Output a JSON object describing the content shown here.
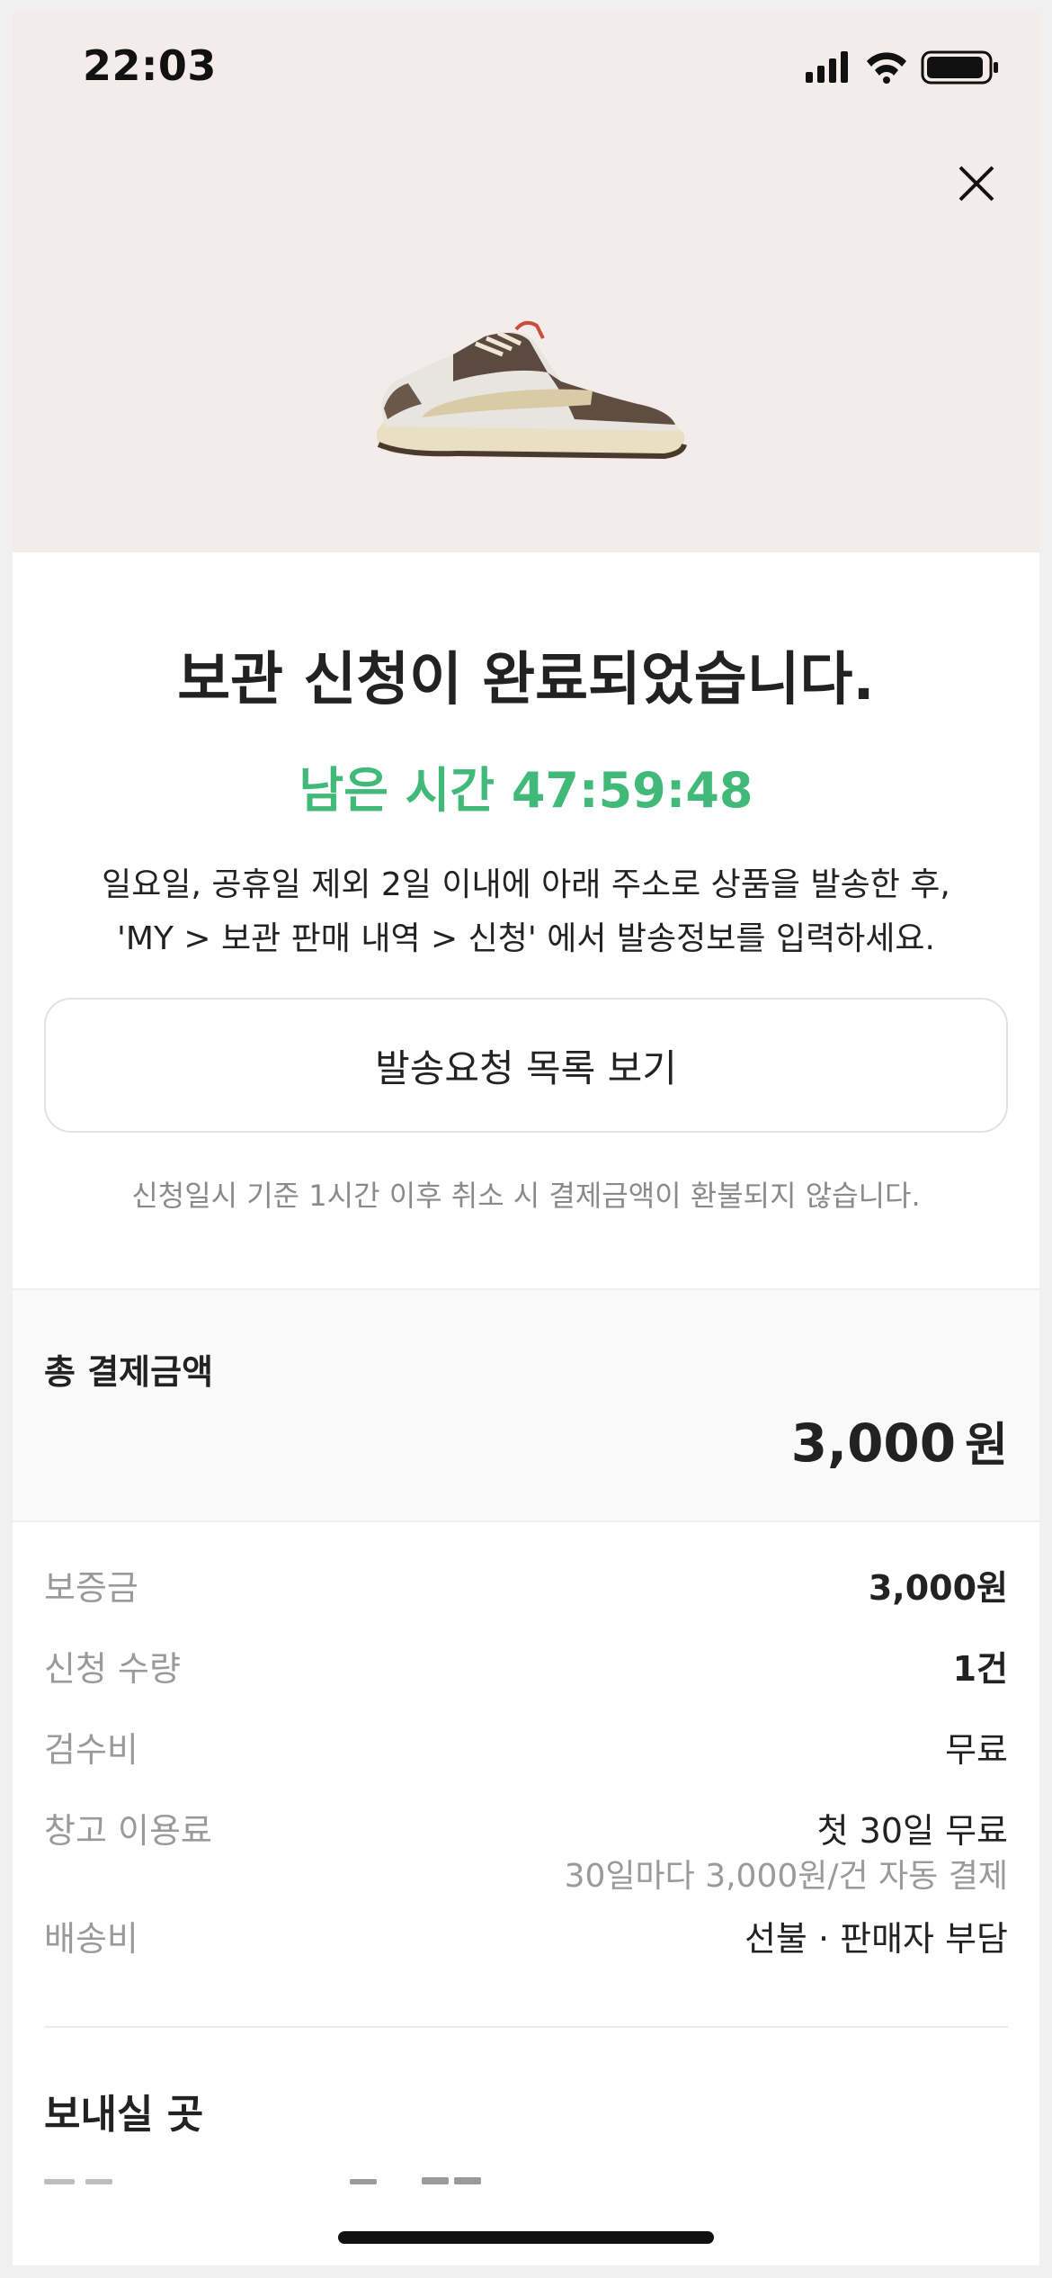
{
  "status_bar": {
    "time": "22:03",
    "icons": [
      "signal-icon",
      "wifi-icon",
      "battery-icon"
    ]
  },
  "header": {
    "close_icon": "close-icon",
    "product_image": "sneaker-image"
  },
  "main": {
    "title": "보관 신청이 완료되었습니다.",
    "timer_label": "남은 시간 47:59:48",
    "guide_line1": "일요일, 공휴일 제외 2일 이내에 아래 주소로 상품을 발송한 후,",
    "guide_line2": "'MY > 보관 판매 내역 > 신청' 에서 발송정보를 입력하세요.",
    "request_button": "발송요청 목록 보기",
    "notice": "신청일시 기준 1시간 이후 취소 시 결제금액이 환불되지 않습니다."
  },
  "total": {
    "label": "총 결제금액",
    "amount": "3,000",
    "unit": "원"
  },
  "details": [
    {
      "label": "보증금",
      "value": "3,000원",
      "bold": true
    },
    {
      "label": "신청 수량",
      "value": "1건",
      "bold": true
    },
    {
      "label": "검수비",
      "value": "무료",
      "bold": false
    },
    {
      "label": "창고 이용료",
      "value": "첫 30일 무료",
      "sub": "30일마다 3,000원/건 자동 결제",
      "bold": false
    },
    {
      "label": "배송비",
      "value": "선불 · 판매자 부담",
      "bold": false
    }
  ],
  "shipping": {
    "section_title": "보내실 곳"
  },
  "colors": {
    "hero_bg": "#f4ecea",
    "timer_green": "#41b979",
    "text_dark": "#222222",
    "text_gray": "#9a9a9a"
  }
}
